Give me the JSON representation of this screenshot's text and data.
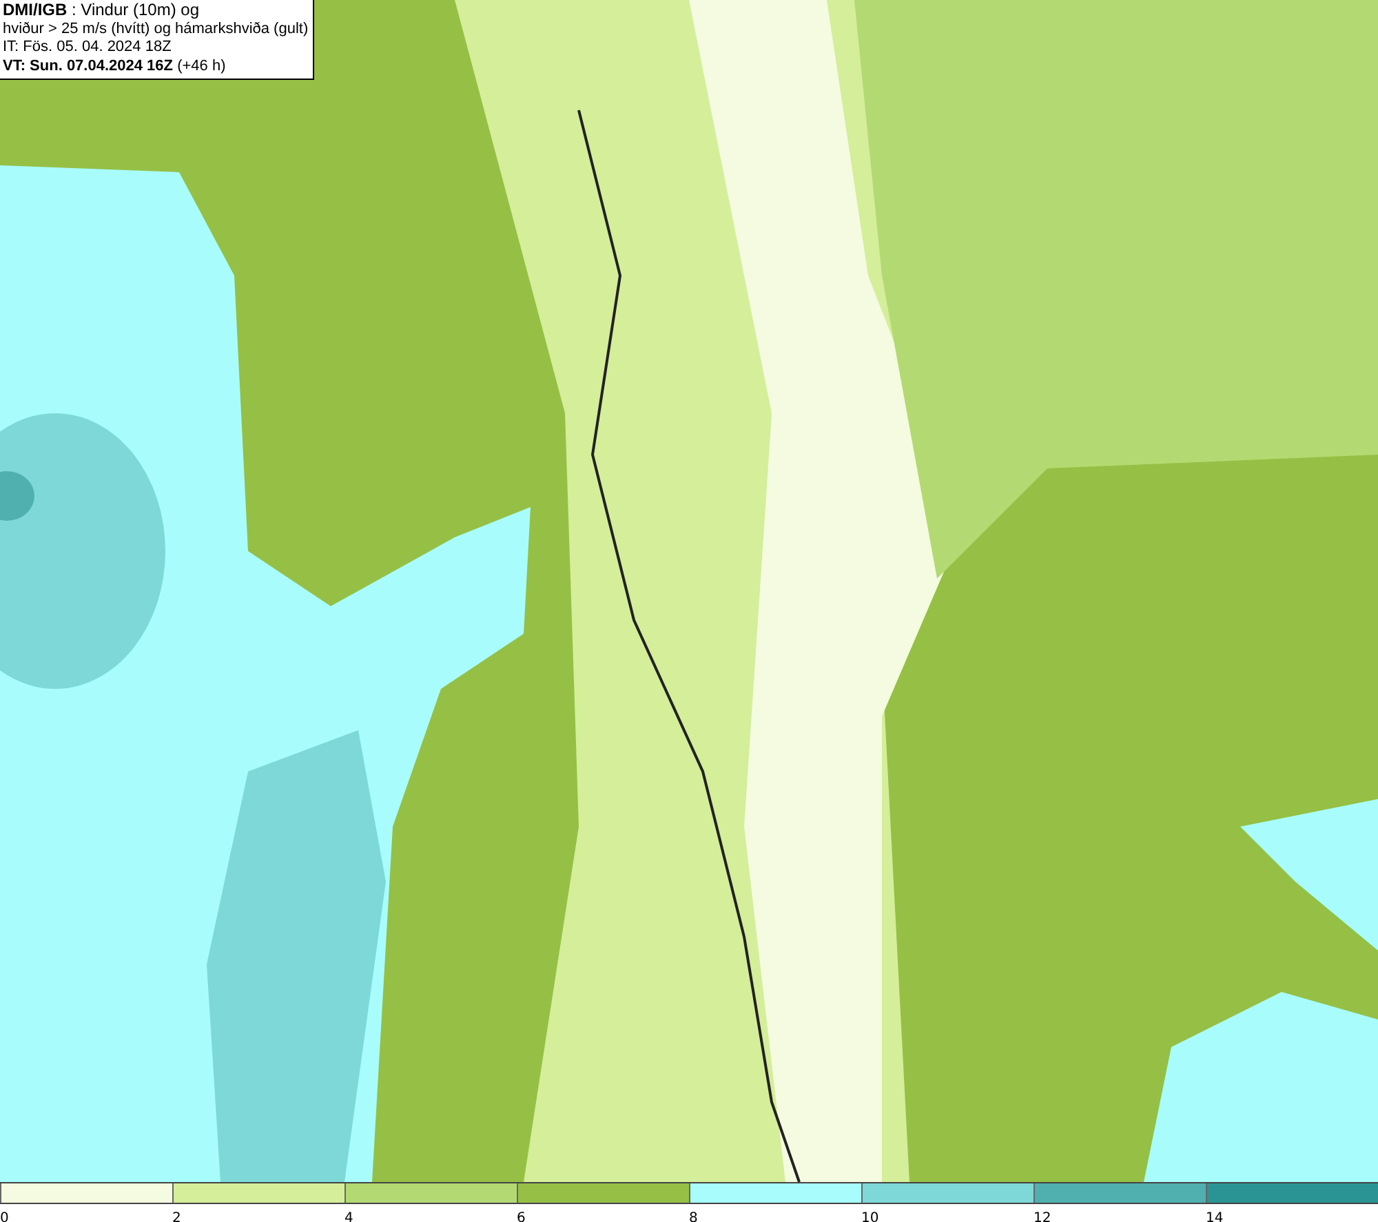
{
  "header": {
    "lines": [
      "**DMI/IGB** : Vindur (10m) og",
      "hviður > 25 m/s (hvítt) og hámarkshviða (gult)",
      "IT: Fös. 05. 04. 2024 18Z",
      "**VT: Sun. 07.04.2024 16Z** (+46 h)"
    ]
  },
  "legend": {
    "swatches": [
      {
        "color": "#f4fbe0",
        "label": "0"
      },
      {
        "color": "#d4ee9a",
        "label": "2"
      },
      {
        "color": "#b3da72",
        "label": "4"
      },
      {
        "color": "#95c045",
        "label": "6"
      },
      {
        "color": "#a8fcfc",
        "label": "8"
      },
      {
        "color": "#7ed8d8",
        "label": "10"
      },
      {
        "color": "#50b0b0",
        "label": "12"
      },
      {
        "color": "#2a9494",
        "label": "14"
      }
    ]
  }
}
